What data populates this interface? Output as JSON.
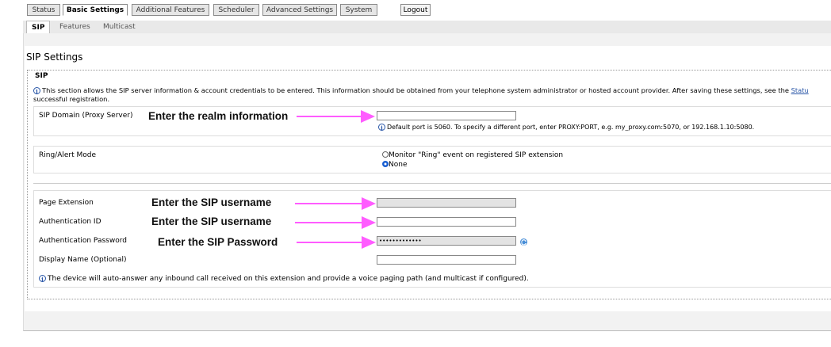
{
  "tabs": [
    "Status",
    "Basic Settings",
    "Additional Features",
    "Scheduler",
    "Advanced Settings",
    "System"
  ],
  "logout_label": "Logout",
  "subtabs": [
    "SIP",
    "Features",
    "Multicast"
  ],
  "page_title": "SIP Settings",
  "fieldset_legend": "SIP",
  "description": {
    "line1": "This section allows the SIP server information & account credentials to be entered. This information should be obtained from your telephone system administrator or hosted account provider. After saving these settings, see the",
    "link": "Statu",
    "line2": "successful registration."
  },
  "sip_domain": {
    "label": "SIP Domain (Proxy Server)",
    "value": "",
    "hint": "Default port is 5060. To specify a different port, enter PROXY:PORT, e.g. my_proxy.com:5070, or 192.168.1.10:5080."
  },
  "ring_mode": {
    "label": "Ring/Alert Mode",
    "options": [
      "Monitor \"Ring\" event on registered SIP extension",
      "None"
    ],
    "selected": "None"
  },
  "credentials": {
    "page_extension_label": "Page Extension",
    "page_extension_value": "",
    "auth_id_label": "Authentication ID",
    "auth_id_value": "",
    "auth_password_label": "Authentication Password",
    "auth_password_value": "•••••••••••••",
    "display_name_label": "Display Name (Optional)",
    "display_name_value": "",
    "note": "The device will auto-answer any inbound call received on this extension and provide a voice paging path (and multicast if configured)."
  },
  "annotations": {
    "realm": "Enter the realm information",
    "sip_username_1": "Enter the SIP username",
    "sip_username_2": "Enter the SIP username",
    "sip_password": "Enter the SIP Password",
    "arrow_color": "#ff5cff"
  },
  "icons": {
    "info": "info-icon",
    "refresh": "refresh-icon"
  }
}
